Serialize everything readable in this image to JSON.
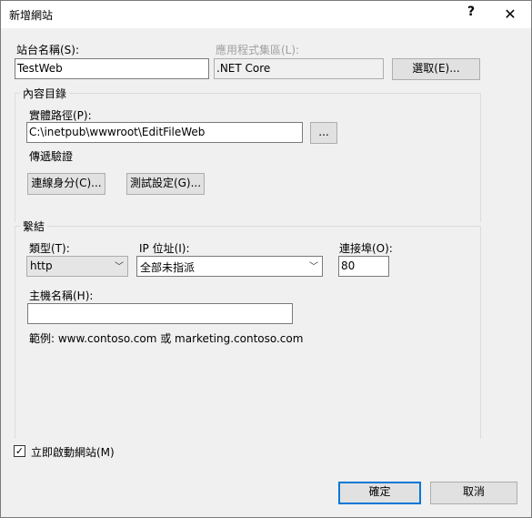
{
  "window": {
    "title": "新增網站",
    "help": "?",
    "close": "✕"
  },
  "site_name": {
    "label": "站台名稱(S):",
    "value": "TestWeb"
  },
  "app_pool": {
    "label": "應用程式集區(L):",
    "value": ".NET Core",
    "select_button": "選取(E)..."
  },
  "content_dir": {
    "legend": "內容目錄",
    "physical_path_label": "實體路徑(P):",
    "physical_path": "C:\\inetpub\\wwwroot\\EditFileWeb",
    "browse_button": "...",
    "pass_through_label": "傳遞驗證",
    "connect_as_button": "連線身分(C)...",
    "test_settings_button": "測試設定(G)..."
  },
  "binding": {
    "legend": "繫結",
    "type_label": "類型(T):",
    "type_value": "http",
    "ip_label": "IP 位址(I):",
    "ip_value": "全部未指派",
    "port_label": "連接埠(O):",
    "port_value": "80",
    "host_label": "主機名稱(H):",
    "host_value": "",
    "example": "範例: www.contoso.com 或 marketing.contoso.com"
  },
  "start_immediately": {
    "label": "立即啟動網站(M)",
    "checked": true
  },
  "footer": {
    "ok": "確定",
    "cancel": "取消"
  }
}
